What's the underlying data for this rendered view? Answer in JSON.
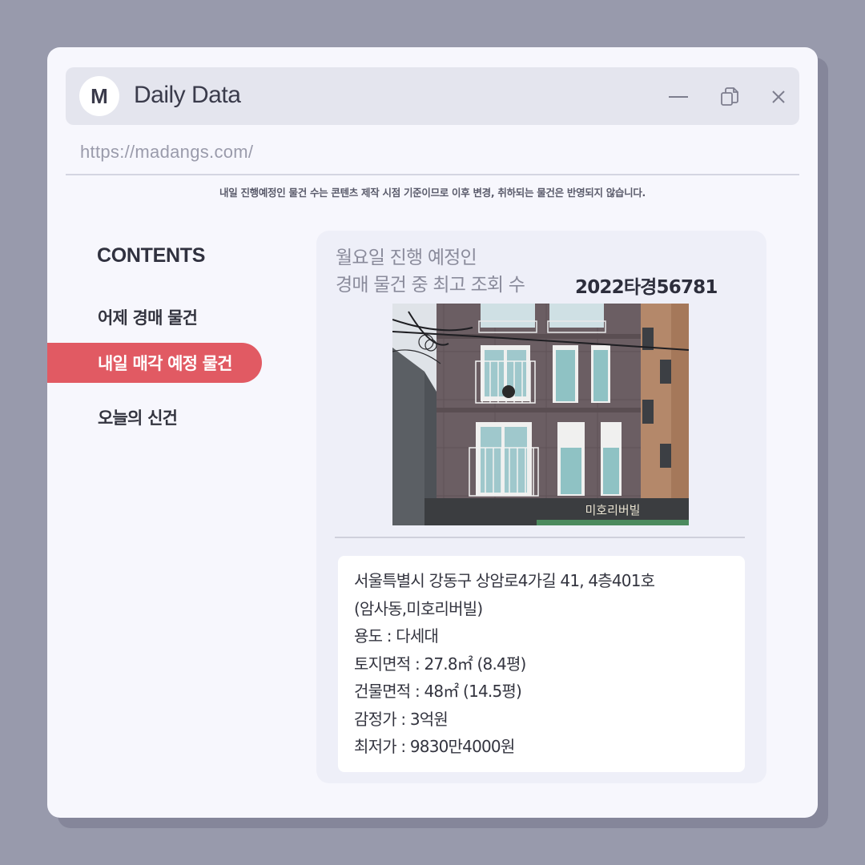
{
  "window": {
    "logo_letter": "M",
    "title": "Daily Data",
    "url": "https://madangs.com/"
  },
  "notice": "내일 진행예정인 물건 수는 콘텐츠 제작 시점 기준이므로 이후 변경, 취하되는 물건은 반영되지 않습니다.",
  "sidebar": {
    "title": "CONTENTS",
    "items": [
      {
        "label": "어제 경매 물건",
        "active": false
      },
      {
        "label": "내일 매각 예정 물건",
        "active": true
      },
      {
        "label": "오늘의 신건",
        "active": false
      }
    ]
  },
  "card": {
    "heading_line1": "월요일 진행 예정인",
    "heading_line2": "경매 물건 중 최고 조회 수",
    "case_number": "2022타경56781",
    "building_sign": "미호리버빌",
    "details": {
      "address_line1": "서울특별시 강동구 상암로4가길 41, 4층401호",
      "address_line2": "(암사동,미호리버빌)",
      "usage": "용도 : 다세대",
      "land_area": "토지면적 : 27.8㎡ (8.4평)",
      "building_area": "건물면적 : 48㎡ (14.5평)",
      "appraisal": "감정가 : 3억원",
      "minimum_price": "최저가 : 9830만4000원"
    }
  },
  "colors": {
    "background": "#989aac",
    "accent": "#e15a63",
    "window": "#f7f7fd",
    "card": "#eeeff8"
  }
}
